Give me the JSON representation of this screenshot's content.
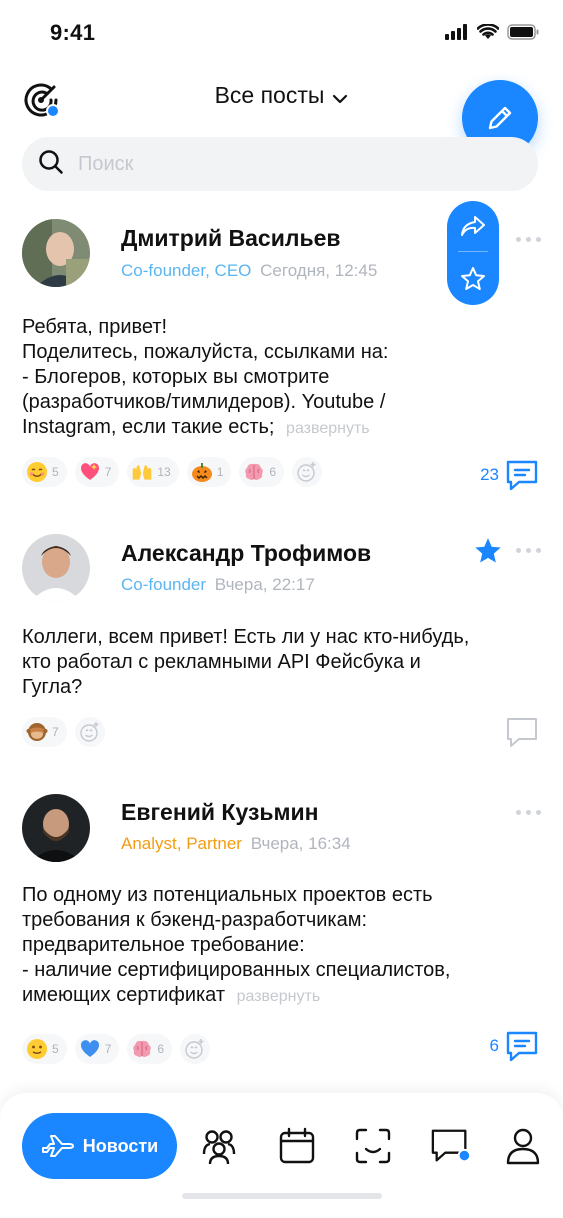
{
  "status_bar": {
    "time": "9:41"
  },
  "header": {
    "title": "Все посты"
  },
  "search": {
    "placeholder": "Поиск"
  },
  "posts": [
    {
      "author": "Дмитрий Васильев",
      "role": "Co-founder, CEO",
      "time": "Сегодня, 12:45",
      "text": "Ребята, привет!\nПоделитесь, пожалуйста, ссылками на:\n- Блогеров, которых вы смотрите\n(разработчиков/тимлидеров). Youtube /\nInstagram, если такие есть;",
      "expand": "развернуть",
      "reactions": [
        {
          "icon": "smiling-face-emoji",
          "count": "5"
        },
        {
          "icon": "sparkling-heart-emoji",
          "count": "7"
        },
        {
          "icon": "raising-hands-emoji",
          "count": "13"
        },
        {
          "icon": "pumpkin-emoji",
          "count": "1"
        },
        {
          "icon": "brain-emoji",
          "count": "6"
        }
      ],
      "comments": "23"
    },
    {
      "author": "Александр Трофимов",
      "role": "Co-founder",
      "time": "Вчера, 22:17",
      "text": "Коллеги, всем привет! Есть ли у нас кто-нибудь,\nкто работал с рекламными API Фейсбука и\nГугла?",
      "reactions": [
        {
          "icon": "see-no-evil-monkey-emoji",
          "count": "7"
        }
      ],
      "starred": true
    },
    {
      "author": "Евгений Кузьмин",
      "role": "Analyst, Partner",
      "time": "Вчера, 16:34",
      "text": "По одному из потенциальных проектов есть\nтребования к бэкенд-разработчикам:\nпредварительное требование:\n- наличие сертифицированных специалистов,\nимеющих сертификат",
      "expand": "развернуть",
      "reactions": [
        {
          "icon": "slightly-smiling-face-emoji",
          "count": "5"
        },
        {
          "icon": "blue-heart-emoji",
          "count": "7"
        },
        {
          "icon": "brain-emoji",
          "count": "6"
        }
      ],
      "comments": "6"
    }
  ],
  "bottom_nav": {
    "news_label": "Новости"
  },
  "colors": {
    "accent": "#1a86ff",
    "role_blue": "#5bb5f0",
    "role_orange": "#f39c12",
    "muted": "#b0b5bd"
  }
}
